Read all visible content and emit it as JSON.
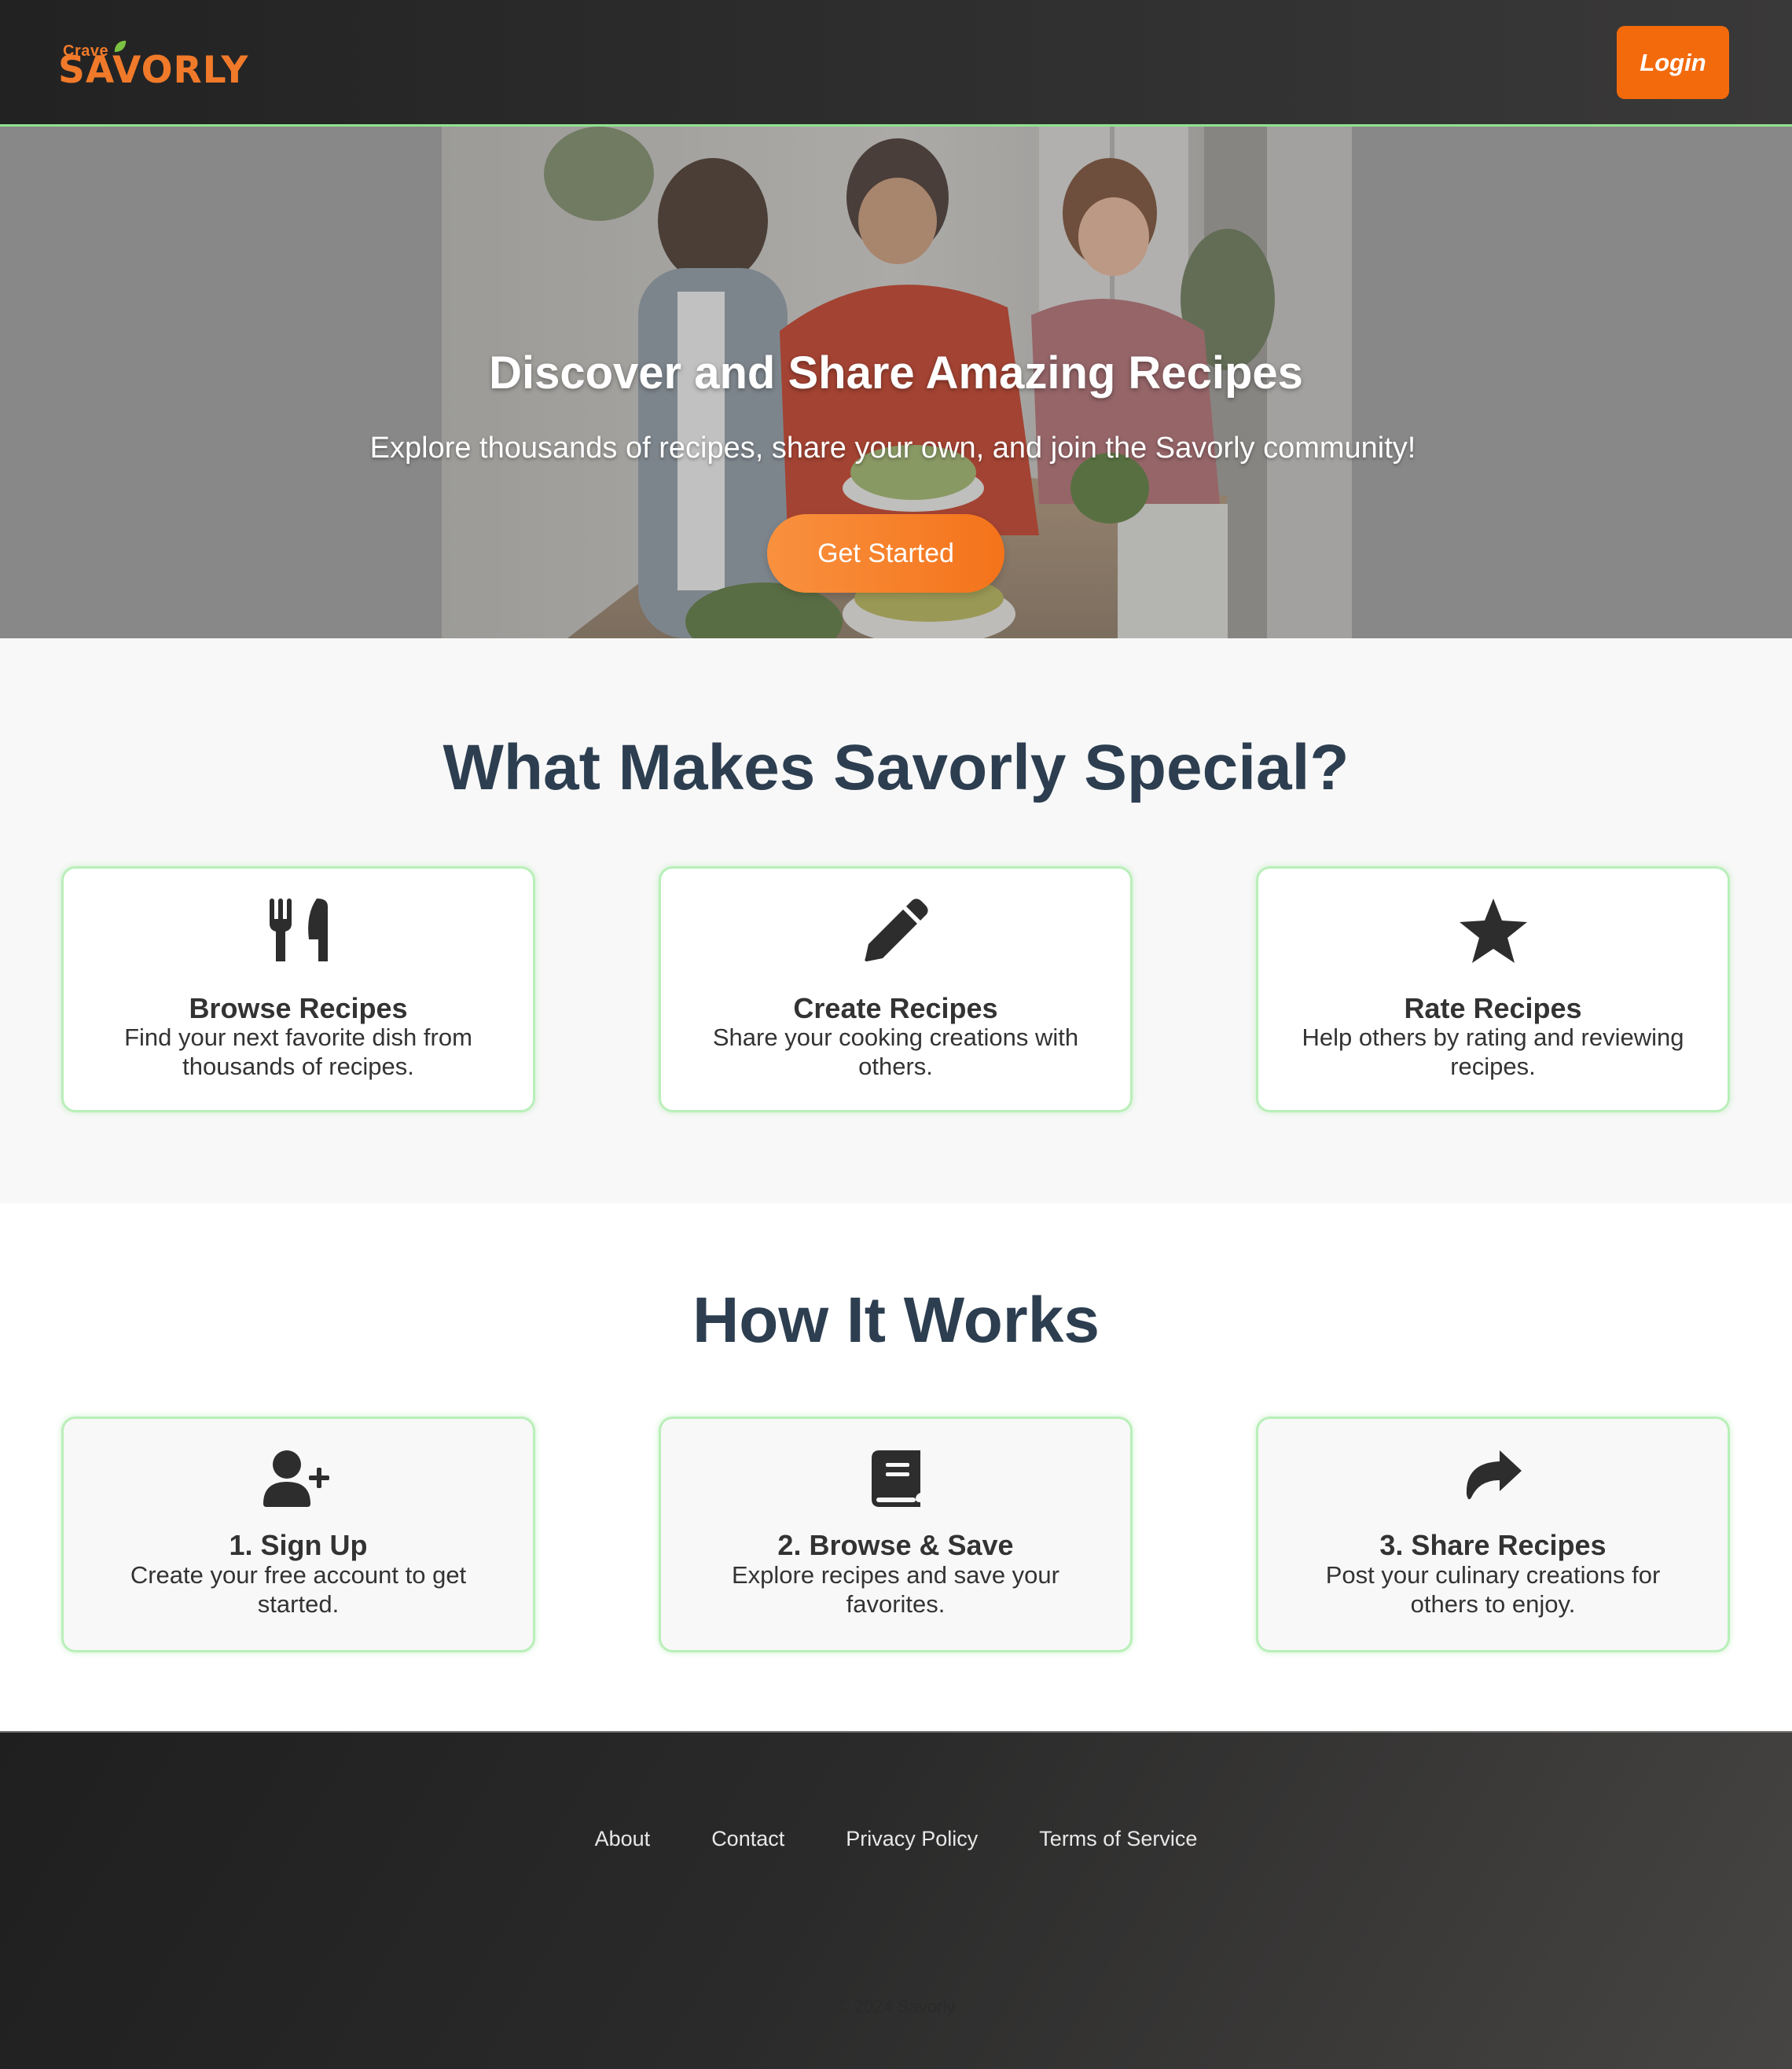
{
  "header": {
    "logo_small": "Crave",
    "logo_main": "SAVORLY",
    "login_label": "Login"
  },
  "hero": {
    "title": "Discover and Share Amazing Recipes",
    "subtitle": "Explore thousands of recipes, share your own, and join the Savorly community!",
    "cta_label": "Get Started"
  },
  "features": {
    "title": "What Makes Savorly Special?",
    "cards": [
      {
        "icon": "utensils-icon",
        "title": "Browse Recipes",
        "desc": "Find your next favorite dish from thousands of recipes."
      },
      {
        "icon": "pencil-icon",
        "title": "Create Recipes",
        "desc": "Share your cooking creations with others."
      },
      {
        "icon": "star-icon",
        "title": "Rate Recipes",
        "desc": "Help others by rating and reviewing recipes."
      }
    ]
  },
  "how": {
    "title": "How It Works",
    "steps": [
      {
        "icon": "user-plus-icon",
        "title": "1. Sign Up",
        "desc": "Create your free account to get started."
      },
      {
        "icon": "book-icon",
        "title": "2. Browse & Save",
        "desc": "Explore recipes and save your favorites."
      },
      {
        "icon": "share-icon",
        "title": "3. Share Recipes",
        "desc": "Post your culinary creations for others to enjoy."
      }
    ]
  },
  "footer": {
    "links": [
      "About",
      "Contact",
      "Privacy Policy",
      "Terms of Service"
    ],
    "copyright": "© 2024 Savorly"
  },
  "colors": {
    "brand_orange": "#f36a0c",
    "heading_navy": "#2c3e50",
    "card_border_green": "#b9efb9"
  }
}
